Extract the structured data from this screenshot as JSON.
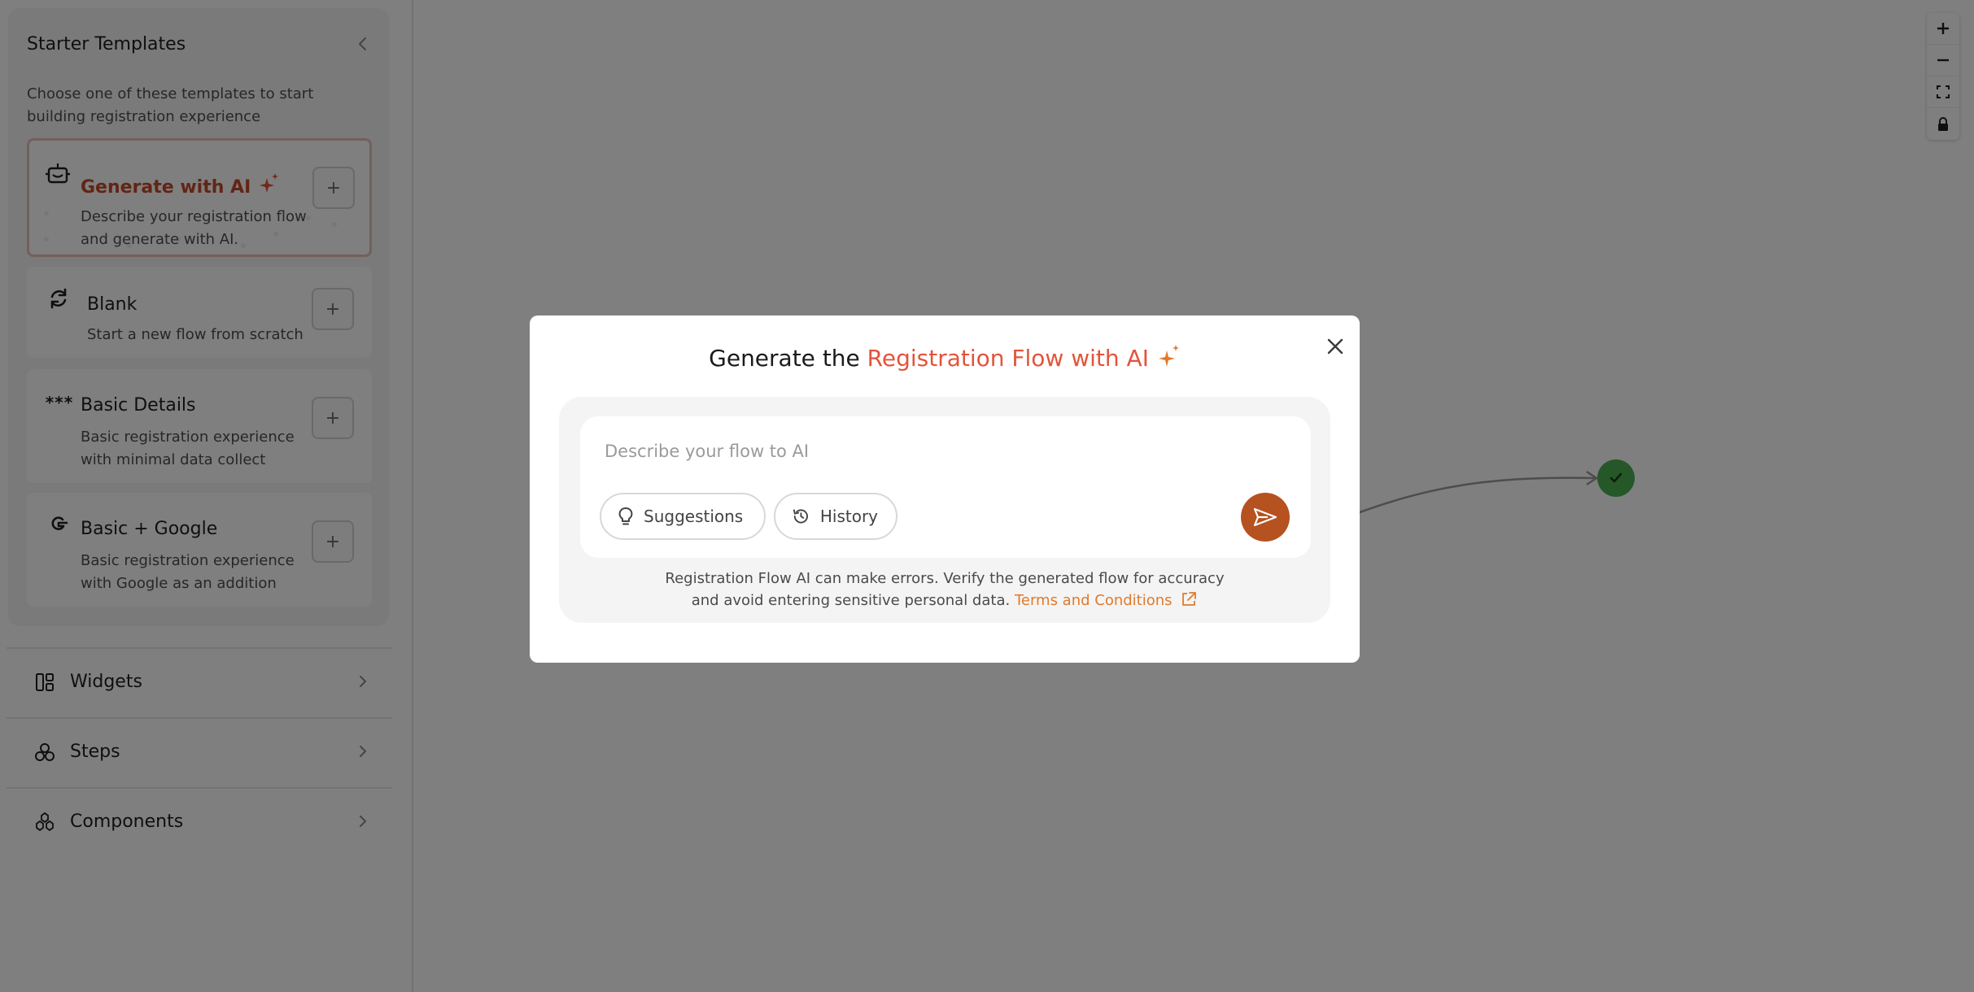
{
  "sidebar": {
    "starter": {
      "title": "Starter Templates",
      "description": "Choose one of these templates to start building registration experience",
      "templates": [
        {
          "title": "Generate with AI",
          "description": "Describe your registration flow and generate with AI.",
          "icon": "robot-icon"
        },
        {
          "title": "Blank",
          "description": "Start a new flow from scratch",
          "icon": "refresh-icon"
        },
        {
          "title": "Basic Details",
          "description": "Basic registration experience with minimal data collect",
          "icon": "asterisks-icon"
        },
        {
          "title": "Basic + Google",
          "description": "Basic registration experience with Google as an addition",
          "icon": "google-icon"
        }
      ],
      "add_symbol": "+"
    },
    "nav": [
      {
        "label": "Widgets",
        "icon": "widgets-icon"
      },
      {
        "label": "Steps",
        "icon": "steps-icon"
      },
      {
        "label": "Components",
        "icon": "components-icon"
      }
    ]
  },
  "modal": {
    "title_prefix": "Generate the ",
    "title_accent": "Registration Flow with AI",
    "prompt": {
      "placeholder": "Describe your flow to AI",
      "value": ""
    },
    "chips": {
      "suggestions": "Suggestions",
      "history": "History"
    },
    "disclaimer_line1": "Registration Flow AI can make errors. Verify the generated flow for accuracy",
    "disclaimer_line2": "and avoid entering sensitive personal data.",
    "terms_label": "Terms and Conditions"
  },
  "colors": {
    "accent": "#e4533a",
    "send_button": "#b5521f",
    "terms_link": "#e07a2c",
    "end_node": "#4caf50"
  }
}
